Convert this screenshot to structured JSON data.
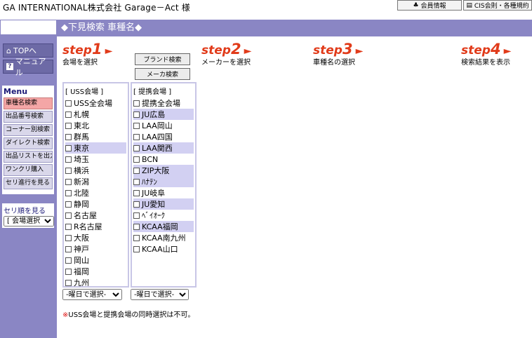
{
  "header": {
    "title": "GA  INTERNATIONAL株式会社 Garage－Act 様",
    "buttons": [
      {
        "label": "会員情報",
        "icon": "club-icon"
      },
      {
        "label": "CIS会則・各種規約",
        "icon": "document-icon"
      }
    ]
  },
  "title_bar": "◆下見検索  車種名◆",
  "sidebar": {
    "top_label": "TOPへ",
    "manual_label": "マニュアル",
    "menu_heading": "Menu",
    "menu_items": [
      {
        "label": "車種名検索",
        "active": true
      },
      {
        "label": "出品番号検索",
        "active": false
      },
      {
        "label": "コーナー別検索",
        "active": false
      },
      {
        "label": "ダイレクト検索",
        "active": false
      },
      {
        "label": "出品リストを出力",
        "active": false
      },
      {
        "label": "ワンクリ購入",
        "active": false
      },
      {
        "label": "セリ進行を見る",
        "active": false
      }
    ],
    "seri_label": "セリ順を見る",
    "venue_select": "[ 会場選択 ]"
  },
  "steps": [
    {
      "word": "step",
      "number": "1",
      "desc": "会場を選択"
    },
    {
      "word": "step",
      "number": "2",
      "desc": "メーカーを選択"
    },
    {
      "word": "step",
      "number": "3",
      "desc": "車種名の選択"
    },
    {
      "word": "step",
      "number": "4",
      "desc": "検索結果を表示"
    }
  ],
  "brand_search_label": "ブランド検索",
  "maker_search_label": "メーカ検索",
  "uss": {
    "heading": "[ USS会場 ]",
    "items": [
      {
        "label": "USS全会場",
        "hl": false
      },
      {
        "label": "札幌",
        "hl": false
      },
      {
        "label": "東北",
        "hl": false
      },
      {
        "label": "群馬",
        "hl": false
      },
      {
        "label": "東京",
        "hl": true
      },
      {
        "label": "埼玉",
        "hl": false
      },
      {
        "label": "横浜",
        "hl": false
      },
      {
        "label": "新潟",
        "hl": false
      },
      {
        "label": "北陸",
        "hl": false
      },
      {
        "label": "静岡",
        "hl": false
      },
      {
        "label": "名古屋",
        "hl": false
      },
      {
        "label": "R名古屋",
        "hl": false
      },
      {
        "label": "大阪",
        "hl": false
      },
      {
        "label": "神戸",
        "hl": false
      },
      {
        "label": "岡山",
        "hl": false
      },
      {
        "label": "福岡",
        "hl": false
      },
      {
        "label": "九州",
        "hl": false
      }
    ],
    "day_select": "-曜日で選択-"
  },
  "partner": {
    "heading": "[ 提携会場 ]",
    "items": [
      {
        "label": "提携全会場",
        "hl": false
      },
      {
        "label": "JU広島",
        "hl": true
      },
      {
        "label": "LAA岡山",
        "hl": false
      },
      {
        "label": "LAA四国",
        "hl": false
      },
      {
        "label": "LAA関西",
        "hl": true
      },
      {
        "label": "BCN",
        "hl": false
      },
      {
        "label": "ZIP大阪",
        "hl": true
      },
      {
        "label": "ﾊﾅﾃﾝ",
        "hl": true
      },
      {
        "label": "JU岐阜",
        "hl": false
      },
      {
        "label": "JU愛知",
        "hl": true
      },
      {
        "label": "ﾍﾞｲｵｰｸ",
        "hl": false
      },
      {
        "label": "KCAA福岡",
        "hl": true
      },
      {
        "label": "KCAA南九州",
        "hl": false
      },
      {
        "label": "KCAA山口",
        "hl": false
      }
    ],
    "day_select": "-曜日で選択-"
  },
  "note": {
    "star": "※",
    "text": "USS会場と提携会場の同時選択は不可。"
  },
  "colors": {
    "sidebar": "#8a86c4",
    "highlight": "#d2d0f2",
    "step": "#e13b1a",
    "menu_active": "#f4a6a6"
  }
}
